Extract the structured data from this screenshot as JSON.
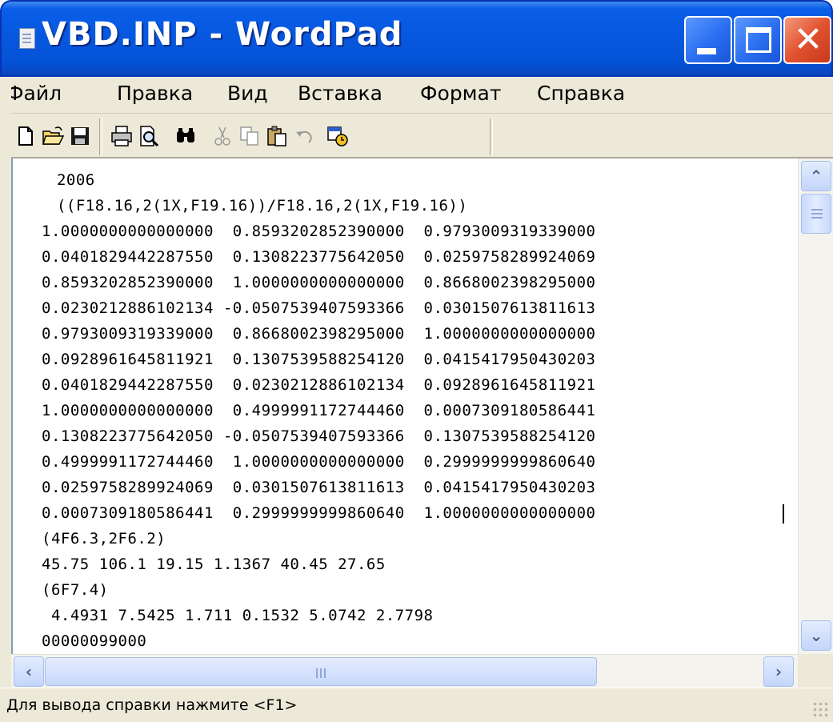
{
  "window": {
    "title": "VBD.INP - WordPad",
    "icons": {
      "app": "wordpad-doc-icon",
      "minimize": "minimize-icon",
      "maximize": "maximize-icon",
      "close": "close-icon"
    }
  },
  "menu": {
    "items": [
      "Файл",
      "Правка",
      "Вид",
      "Вставка",
      "Формат",
      "Справка"
    ]
  },
  "toolbar": {
    "icons": [
      "new-document-icon",
      "open-folder-icon",
      "save-icon",
      "print-icon",
      "print-preview-icon",
      "find-icon",
      "cut-icon",
      "copy-icon",
      "paste-icon",
      "undo-icon",
      "insert-date-time-icon"
    ]
  },
  "document": {
    "lines": [
      " 2006",
      " ((F18.16,2(1X,F19.16))/F18.16,2(1X,F19.16))",
      "1.0000000000000000  0.8593202852390000  0.9793009319339000",
      "0.0401829442287550  0.1308223775642050  0.0259758289924069",
      "0.8593202852390000  1.0000000000000000  0.8668002398295000",
      "0.0230212886102134 -0.0507539407593366  0.0301507613811613",
      "0.9793009319339000  0.8668002398295000  1.0000000000000000",
      "0.0928961645811921  0.1307539588254120  0.0415417950430203",
      "0.0401829442287550  0.0230212886102134  0.0928961645811921",
      "1.0000000000000000  0.4999991172744460  0.0007309180586441",
      "0.1308223775642050 -0.0507539407593366  0.1307539588254120",
      "0.4999991172744460  1.0000000000000000  0.2999999999860640",
      "0.0259758289924069  0.0301507613811613  0.0415417950430203",
      "0.0007309180586441  0.2999999999860640  1.0000000000000000",
      "(4F6.3,2F6.2)",
      "45.75 106.1 19.15 1.1367 40.45 27.65",
      "(6F7.4)",
      " 4.4931 7.5425 1.711 0.1532 5.0742 2.7798",
      "00000099000"
    ]
  },
  "scrollbars": {
    "vertical": {
      "up": "scroll-up-arrow-icon",
      "down": "scroll-down-arrow-icon"
    },
    "horizontal": {
      "left": "scroll-left-arrow-icon",
      "right": "scroll-right-arrow-icon"
    }
  },
  "status": {
    "text": "Для вывода справки нажмите <F1>"
  }
}
